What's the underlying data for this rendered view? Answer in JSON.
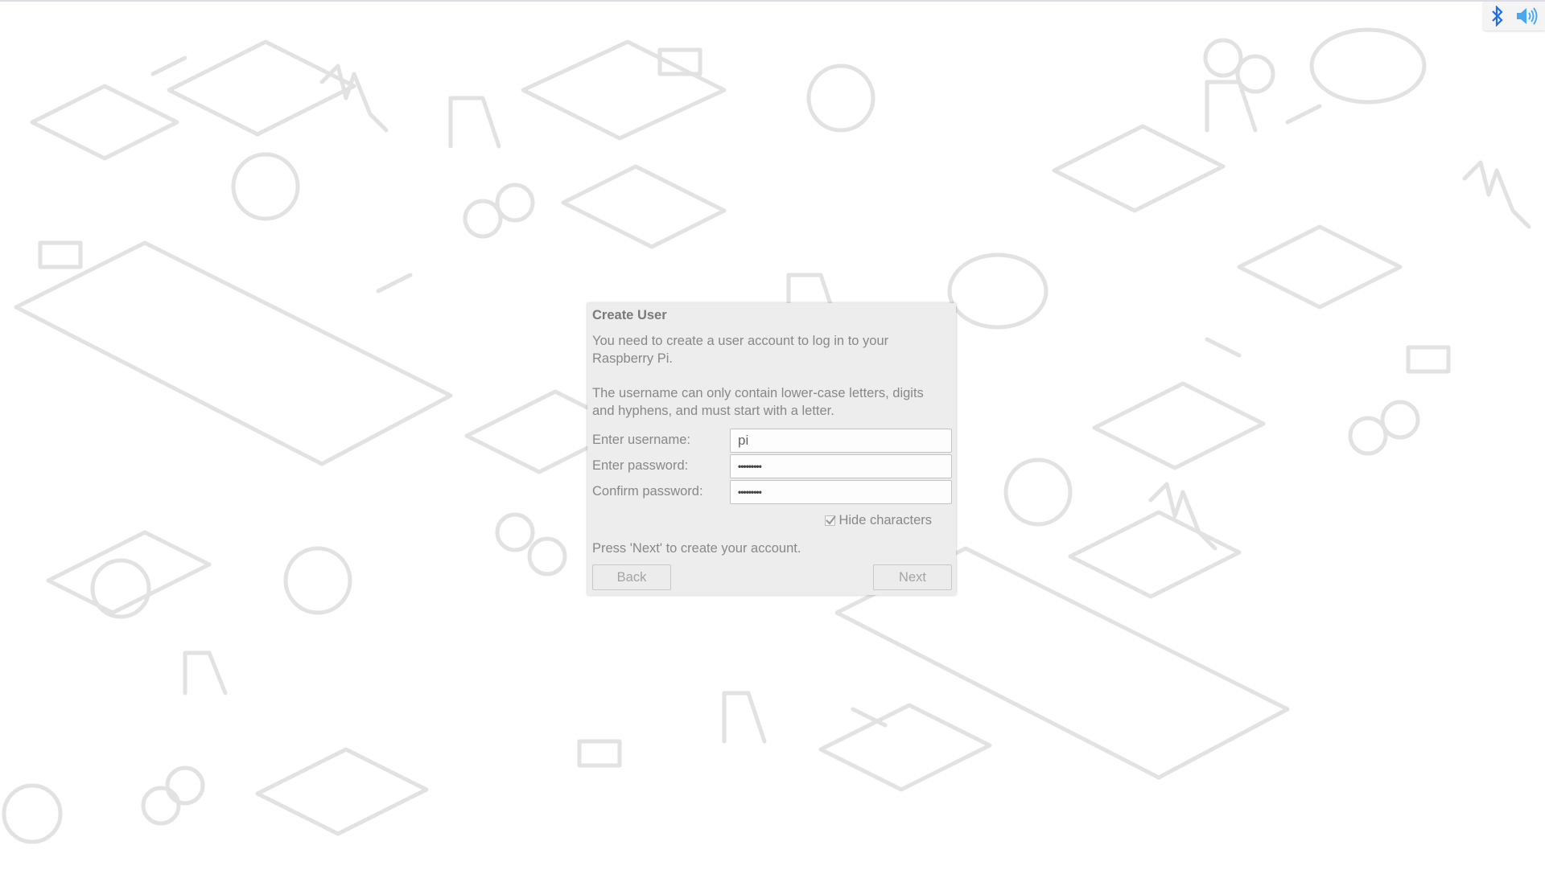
{
  "system_tray": {
    "icons": [
      {
        "name": "bluetooth-icon",
        "color": "#1e6ee8"
      },
      {
        "name": "volume-icon",
        "color": "#4aa7f0"
      }
    ]
  },
  "dialog": {
    "title": "Create User",
    "intro": "You need to create a user account to log in to your Raspberry Pi.",
    "rules": "The username can only contain lower-case letters, digits and hyphens, and must start with a letter.",
    "fields": [
      {
        "label": "Enter username:",
        "value": "pi",
        "type": "text"
      },
      {
        "label": "Enter password:",
        "value": "•••••••••",
        "type": "password"
      },
      {
        "label": "Confirm password:",
        "value": "•••••••••",
        "type": "password"
      }
    ],
    "hide_characters": {
      "label": "Hide characters",
      "checked": true
    },
    "hint": "Press 'Next' to create your account.",
    "back_label": "Back",
    "next_label": "Next"
  }
}
